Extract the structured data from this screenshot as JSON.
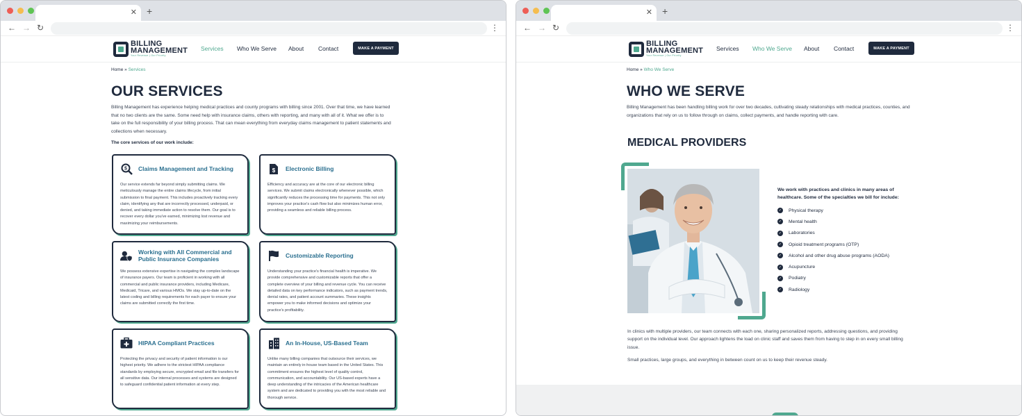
{
  "left": {
    "nav": [
      "Services",
      "Who We Serve",
      "About",
      "Contact"
    ],
    "pay": "MAKE A PAYMENT",
    "logo": {
      "l1": "BILLING",
      "l2": "MANAGEMENT",
      "tag": "Your Revenue | Our Priority"
    },
    "crumb": {
      "home": "Home",
      "sep": "»",
      "current": "Services"
    },
    "title": "OUR SERVICES",
    "intro": "Billing Management has experience helping medical practices and county programs with billing since 2001. Over that time, we have learned that no two clients are the same. Some need help with insurance claims, others with reporting, and many with all of it. What we offer is to take on the full responsibility of your billing process. That can mean everything from everyday claims management to patient statements and collections when necessary.",
    "core": "The core services of our work include:",
    "cards": [
      {
        "title": "Claims Management and Tracking",
        "body": "Our service extends far beyond simply submitting claims. We meticulously manage the entire claims lifecycle, from initial submission to final payment. This includes proactively tracking every claim, identifying any that are incorrectly processed, underpaid, or denied, and taking immediate action to resolve them. Our goal is to recover every dollar you've earned, minimizing lost revenue and maximizing your reimbursements."
      },
      {
        "title": "Electronic Billing",
        "body": "Efficiency and accuracy are at the core of our electronic billing services. We submit claims electronically whenever possible, which significantly reduces the processing time for payments. This not only improves your practice's cash flow but also minimizes human error, providing a seamless and reliable billing process."
      },
      {
        "title": "Working with All Commercial and Public Insurance Companies",
        "body": "We possess extensive expertise in navigating the complex landscape of insurance payers. Our team is proficient in working with all commercial and public insurance providers, including Medicare, Medicaid, Tricare, and various HMOs. We stay up-to-date on the latest coding and billing requirements for each payer to ensure your claims are submitted correctly the first time."
      },
      {
        "title": "Customizable Reporting",
        "body": "Understanding your practice's financial health is imperative. We provide comprehensive and customizable reports that offer a complete overview of your billing and revenue cycle. You can receive detailed data on key performance indicators, such as payment trends, denial rates, and patient account summaries. These insights empower you to make informed decisions and optimize your practice's profitability."
      },
      {
        "title": "HIPAA Compliant Practices",
        "body": "Protecting the privacy and security of patient information is our highest priority. We adhere to the strictest HIPAA compliance standards by employing secure, encrypted email and file transfers for all sensitive data. Our internal processes and systems are designed to safeguard confidential patient information at every step."
      },
      {
        "title": "An In-House, US-Based Team",
        "body": "Unlike many billing companies that outsource their services, we maintain an entirely in-house team based in the United States. This commitment ensures the highest level of quality control, communication, and accountability. Our US-based experts have a deep understanding of the intricacies of the American healthcare system and are dedicated to providing you with the most reliable and thorough service."
      }
    ]
  },
  "right": {
    "crumb": {
      "home": "Home",
      "sep": "»",
      "current": "Who We Serve"
    },
    "title": "WHO WE SERVE",
    "intro": "Billing Management has been handling billing work for over two decades, cultivating steady relationships with medical practices, counties, and organizations that rely on us to follow through on claims, collect payments, and handle reporting with care.",
    "h2": "MEDICAL PROVIDERS",
    "lead": "We work with practices and clinics in many areas of healthcare. Some of the specialties we bill for include:",
    "specialties": [
      "Physical therapy",
      "Mental health",
      "Laboratories",
      "Opioid treatment programs (OTP)",
      "Alcohol and other drug abuse programs (AODA)",
      "Acupuncture",
      "Podiatry",
      "Radiology"
    ],
    "p1": "In clinics with multiple providers, our team connects with each one, sharing personalized reports, addressing questions, and providing support on the individual level. Our approach lightens the load on clinic staff and saves them from having to step in on every small billing issue.",
    "p2": "Small practices, large groups, and everything in between count on us to keep their revenue steady."
  },
  "colors": {
    "navy": "#1f2a3d",
    "green": "#4fa88f",
    "link": "#2a6f8f"
  },
  "icons": [
    "search-dollar-icon",
    "invoice-icon",
    "user-shield-icon",
    "flag-icon",
    "medkit-icon",
    "building-icon",
    "check-circle-icon"
  ]
}
